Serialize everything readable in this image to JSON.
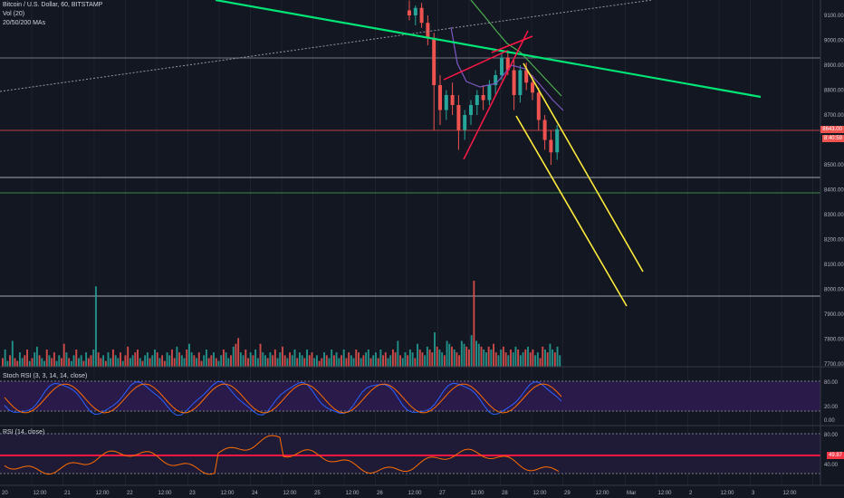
{
  "header": {
    "symbol_line": "Bitcoin / U.S. Dollar, 60, BITSTAMP",
    "volume_label": "Vol (20)",
    "ma_label": "20/50/200 MAs"
  },
  "price_axis": {
    "ticks": [
      "9100.00",
      "9000.00",
      "8900.00",
      "8800.00",
      "8700.00",
      "8600.00",
      "8500.00",
      "8400.00",
      "8300.00",
      "8200.00",
      "8100.00",
      "8000.00",
      "7900.00",
      "7800.00",
      "7700.00"
    ],
    "last_price_tag": "8643.00",
    "time_tag": "8:40:59"
  },
  "stoch_pane": {
    "title": "Stoch RSI (3, 3, 14, 14, close)",
    "ticks": [
      "80.00",
      "20.00",
      "0.00"
    ]
  },
  "rsi_pane": {
    "title": "RSI (14, close)",
    "ticks": [
      "80.00",
      "49.87",
      "40.00"
    ],
    "value_tag": "49.87"
  },
  "time_axis": {
    "labels": [
      "20",
      "12:00",
      "21",
      "12:00",
      "22",
      "12:00",
      "23",
      "12:00",
      "24",
      "12:00",
      "25",
      "12:00",
      "26",
      "12:00",
      "27",
      "12:00",
      "28",
      "12:00",
      "29",
      "12:00",
      "Mar",
      "12:00",
      "2",
      "12:00",
      "3",
      "12:00"
    ]
  },
  "colors": {
    "background": "#131722",
    "up": "#26a69a",
    "down": "#ef5350",
    "trend_green": "#00e676",
    "channel_yellow": "#ffeb3b",
    "wedge_red": "#ff1744",
    "stoch_band": "#2a1a4a"
  },
  "chart_data": {
    "type": "candlestick",
    "price_range": [
      7680,
      9160
    ],
    "candles": [
      {
        "o": 9120,
        "h": 9160,
        "l": 9080,
        "c": 9100
      },
      {
        "o": 9100,
        "h": 9140,
        "l": 9060,
        "c": 9130
      },
      {
        "o": 9130,
        "h": 9150,
        "l": 9050,
        "c": 9070
      },
      {
        "o": 9070,
        "h": 9100,
        "l": 8980,
        "c": 9010
      },
      {
        "o": 9010,
        "h": 9030,
        "l": 8640,
        "c": 8820
      },
      {
        "o": 8820,
        "h": 8860,
        "l": 8660,
        "c": 8720
      },
      {
        "o": 8720,
        "h": 8800,
        "l": 8680,
        "c": 8780
      },
      {
        "o": 8780,
        "h": 8830,
        "l": 8700,
        "c": 8740
      },
      {
        "o": 8740,
        "h": 8780,
        "l": 8560,
        "c": 8640
      },
      {
        "o": 8640,
        "h": 8720,
        "l": 8600,
        "c": 8700
      },
      {
        "o": 8700,
        "h": 8760,
        "l": 8660,
        "c": 8740
      },
      {
        "o": 8740,
        "h": 8800,
        "l": 8700,
        "c": 8780
      },
      {
        "o": 8780,
        "h": 8820,
        "l": 8720,
        "c": 8760
      },
      {
        "o": 8760,
        "h": 8840,
        "l": 8740,
        "c": 8820
      },
      {
        "o": 8820,
        "h": 8880,
        "l": 8780,
        "c": 8860
      },
      {
        "o": 8860,
        "h": 8950,
        "l": 8840,
        "c": 8930
      },
      {
        "o": 8930,
        "h": 8960,
        "l": 8860,
        "c": 8880
      },
      {
        "o": 8880,
        "h": 8920,
        "l": 8720,
        "c": 8780
      },
      {
        "o": 8780,
        "h": 8900,
        "l": 8750,
        "c": 8880
      },
      {
        "o": 8880,
        "h": 8910,
        "l": 8800,
        "c": 8830
      },
      {
        "o": 8830,
        "h": 8860,
        "l": 8760,
        "c": 8790
      },
      {
        "o": 8790,
        "h": 8810,
        "l": 8640,
        "c": 8680
      },
      {
        "o": 8680,
        "h": 8700,
        "l": 8560,
        "c": 8600
      },
      {
        "o": 8600,
        "h": 8640,
        "l": 8500,
        "c": 8550
      },
      {
        "o": 8550,
        "h": 8660,
        "l": 8520,
        "c": 8643
      }
    ],
    "volume": [
      3,
      6,
      2,
      4,
      9,
      3,
      2,
      5,
      3,
      4,
      6,
      2,
      3,
      5,
      7,
      4,
      3,
      2,
      6,
      4,
      3,
      5,
      2,
      4,
      3,
      8,
      5,
      3,
      2,
      4,
      6,
      3,
      4,
      2,
      5,
      3,
      4,
      6,
      28,
      5,
      3,
      4,
      2,
      5,
      3,
      6,
      4,
      3,
      5,
      2,
      4,
      7,
      3,
      4,
      5,
      6,
      3,
      2,
      4,
      5,
      3,
      4,
      6,
      5,
      3,
      4,
      2,
      5,
      4,
      6,
      3,
      7,
      5,
      4,
      3,
      6,
      8,
      5,
      4,
      3,
      5,
      2,
      4,
      6,
      3,
      4,
      5,
      3,
      2,
      4,
      6,
      5,
      3,
      4,
      7,
      8,
      10,
      5,
      4,
      6,
      3,
      5,
      4,
      6,
      3,
      8,
      5,
      4,
      3,
      5,
      4,
      6,
      3,
      5,
      7,
      4,
      3,
      5,
      4,
      6,
      3,
      5,
      4,
      3,
      6,
      4,
      5,
      3,
      4,
      2,
      3,
      5,
      4,
      3,
      6,
      4,
      5,
      3,
      4,
      6,
      3,
      5,
      4,
      3,
      6,
      5,
      3,
      4,
      5,
      6,
      3,
      4,
      5,
      3,
      6,
      4,
      5,
      3,
      4,
      6,
      5,
      9,
      4,
      3,
      5,
      4,
      6,
      5,
      3,
      8,
      6,
      5,
      4,
      7,
      6,
      5,
      12,
      7,
      6,
      5,
      4,
      9,
      8,
      7,
      6,
      5,
      4,
      9,
      8,
      7,
      6,
      11,
      30,
      9,
      8,
      7,
      6,
      5,
      7,
      6,
      8,
      5,
      4,
      6,
      7,
      5,
      4,
      6,
      5,
      7,
      6,
      4,
      5,
      6,
      7,
      5,
      6,
      4,
      5,
      3,
      7,
      6,
      5,
      8,
      6,
      5,
      7,
      4
    ]
  }
}
